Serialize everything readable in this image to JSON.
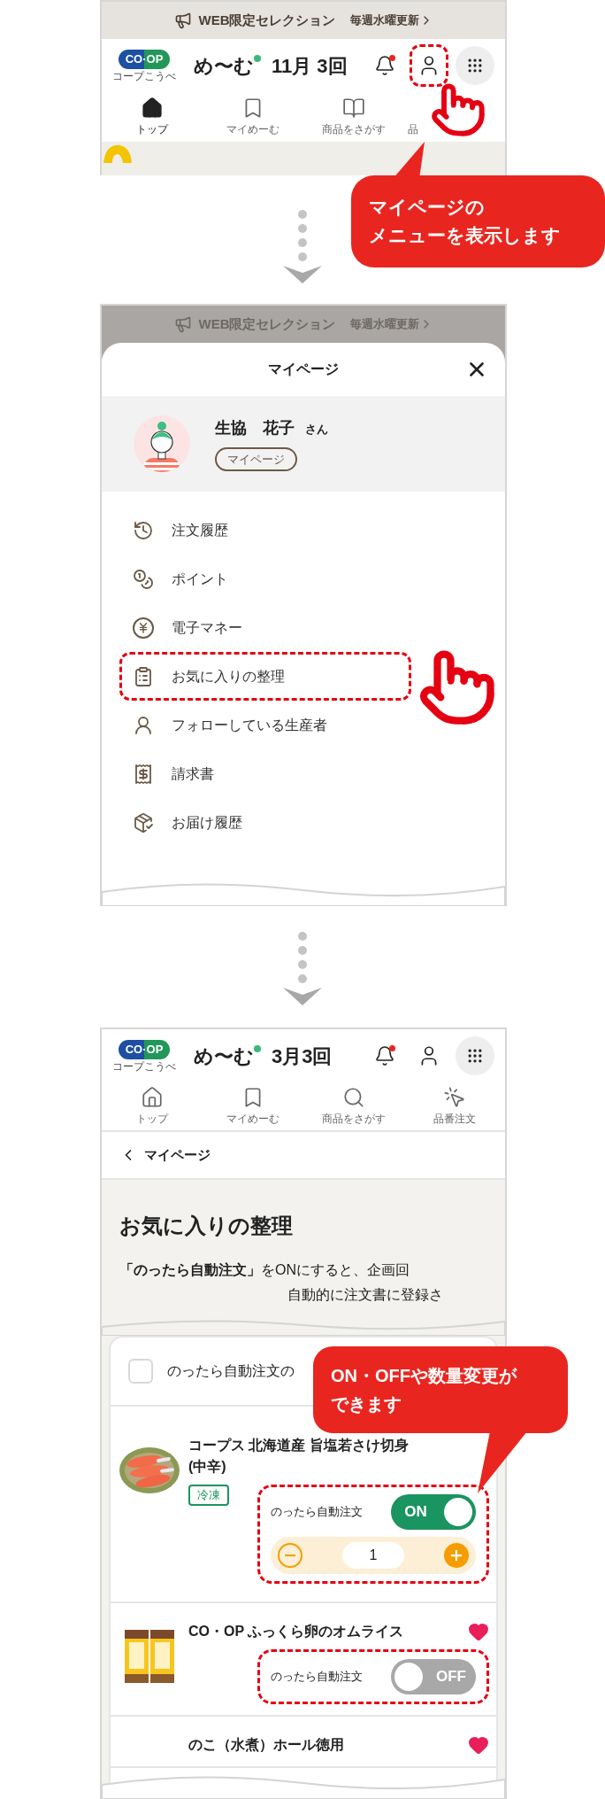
{
  "screen_1": {
    "banner": {
      "text": "WEB限定セレクション",
      "link": "毎週水曜更新"
    },
    "header": {
      "logo": "CO·OP",
      "logo_caption": "コープこうべ",
      "app_name": "め〜む",
      "period": "11月 3回",
      "has_notification": true,
      "account_highlighted": true
    },
    "nav": [
      {
        "label": "トップ",
        "selected": true
      },
      {
        "label": "マイめーむ",
        "selected": false
      },
      {
        "label": "商品をさがす",
        "selected": false
      },
      {
        "label": "品",
        "selected": false
      }
    ],
    "callout": [
      "マイページの",
      "メニューを表示します"
    ]
  },
  "screen_2": {
    "banner": {
      "text": "WEB限定セレクション",
      "link": "毎週水曜更新"
    },
    "sheet": {
      "title": "マイページ",
      "user_name": "生協　花子",
      "honorific": "さん",
      "mypage_button": "マイページ",
      "menu": [
        {
          "label": "注文履歴",
          "highlighted": false
        },
        {
          "label": "ポイント",
          "highlighted": false
        },
        {
          "label": "電子マネー",
          "highlighted": false
        },
        {
          "label": "お気に入りの整理",
          "highlighted": true
        },
        {
          "label": "フォローしている生産者",
          "highlighted": false
        },
        {
          "label": "請求書",
          "highlighted": false
        },
        {
          "label": "お届け履歴",
          "highlighted": false
        }
      ]
    }
  },
  "screen_3": {
    "header": {
      "logo": "CO·OP",
      "logo_caption": "コープこうべ",
      "app_name": "め〜む",
      "period": "3月3回",
      "has_notification": true,
      "account_highlighted": false
    },
    "nav": [
      {
        "label": "トップ",
        "selected": false
      },
      {
        "label": "マイめーむ",
        "selected": false
      },
      {
        "label": "商品をさがす",
        "selected": false
      },
      {
        "label": "品番注文",
        "selected": false
      }
    ],
    "back": "マイページ",
    "title": "お気に入りの整理",
    "intro": [
      "**「のったら自動注文」**をONにすると、企画回",
      "自動的に注文書に登録さ"
    ],
    "select_all": {
      "label": "のったら自動注文の",
      "checked": false
    },
    "callout": [
      "ON・OFFや数量変更が",
      "できます"
    ],
    "products": [
      {
        "name": "コープス 北海道産 旨塩若さけ切身\n(中辛)",
        "tag": "冷凍",
        "favorite": false,
        "auto_order": {
          "label": "のったら自動注文",
          "on": true,
          "toggle_text": "ON",
          "highlighted": true
        },
        "quantity": "1"
      },
      {
        "name": "CO・OP ふっくら卵のオムライス",
        "favorite": true,
        "auto_order": {
          "label": "のったら自動注文",
          "on": false,
          "toggle_text": "OFF",
          "highlighted": true
        }
      },
      {
        "name": "のこ（水煮）ホール徳用",
        "favorite": true
      }
    ]
  }
}
